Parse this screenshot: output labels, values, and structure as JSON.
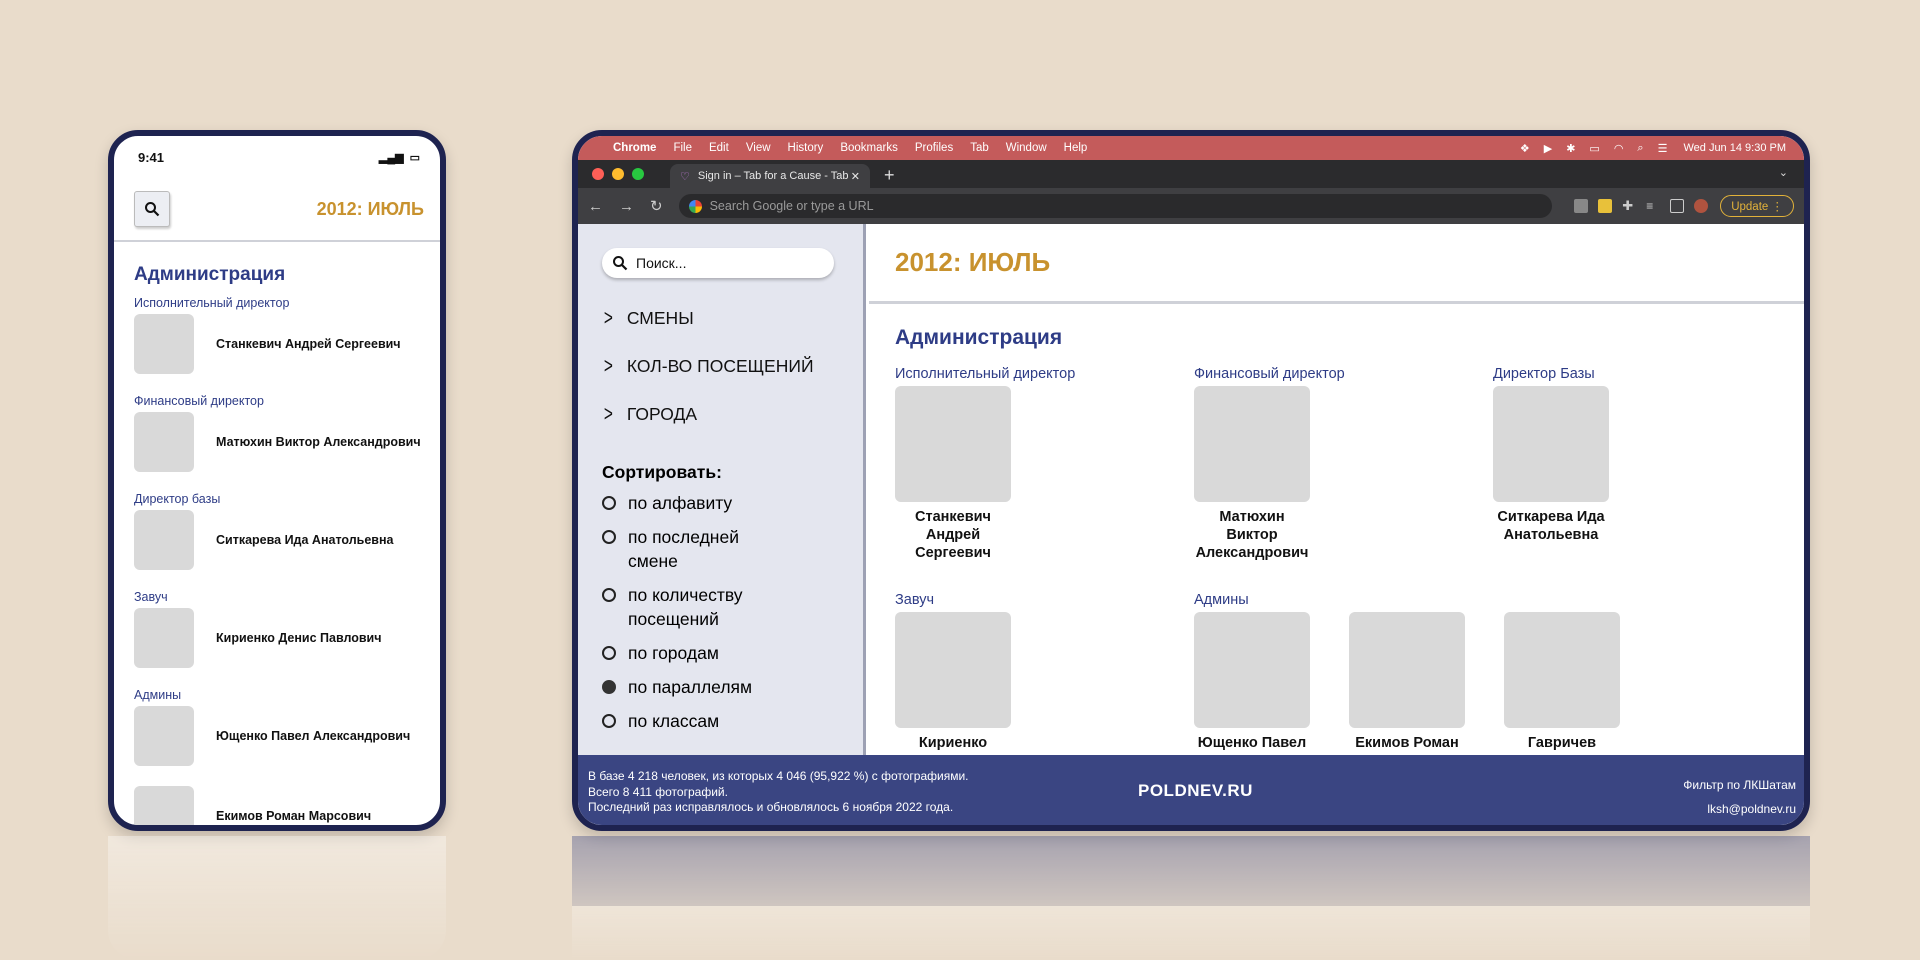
{
  "phone": {
    "status": {
      "time": "9:41"
    },
    "header": {
      "title": "2012: ИЮЛЬ"
    },
    "section": "Администрация",
    "entries": [
      {
        "role": "Исполнительный директор",
        "name": "Станкевич Андрей Сергеевич"
      },
      {
        "role": "Финансовый директор",
        "name": "Матюхин Виктор Александрович"
      },
      {
        "role": "Директор базы",
        "name": "Ситкарева Ида Анатольевна"
      },
      {
        "role": "Завуч",
        "name": "Кириенко Денис Павлович"
      },
      {
        "role": "Админы",
        "name": "Ющенко Павел Александрович"
      },
      {
        "role": "",
        "name": "Екимов Роман Марсович"
      }
    ]
  },
  "mac": {
    "menu": [
      "Chrome",
      "File",
      "Edit",
      "View",
      "History",
      "Bookmarks",
      "Profiles",
      "Tab",
      "Window",
      "Help"
    ],
    "datetime": "Wed Jun 14  9:30 PM"
  },
  "browser": {
    "tab_title": "Sign in – Tab for a Cause - Tab",
    "omnibox_placeholder": "Search Google or type a URL",
    "update_label": "Update"
  },
  "sidebar": {
    "search_placeholder": "Поиск...",
    "menu": [
      "СМЕНЫ",
      "КОЛ-ВО ПОСЕЩЕНИЙ",
      "ГОРОДА"
    ],
    "sort_label": "Сортировать:",
    "sort_options": [
      {
        "label": "по алфавиту",
        "selected": false
      },
      {
        "label": "по последней смене",
        "selected": false
      },
      {
        "label": "по количеству посещений",
        "selected": false
      },
      {
        "label": "по городам",
        "selected": false
      },
      {
        "label": "по параллелям",
        "selected": true
      },
      {
        "label": "по классам",
        "selected": false
      }
    ]
  },
  "main": {
    "title": "2012: ИЮЛЬ",
    "section": "Администрация",
    "groups": [
      {
        "role": "Исполнительный директор",
        "people": [
          "Станкевич Андрей Сергеевич"
        ]
      },
      {
        "role": "Финансовый директор",
        "people": [
          "Матюхин Виктор Александрович"
        ]
      },
      {
        "role": "Директор Базы",
        "people": [
          "Ситкарева Ида Анатольевна"
        ]
      },
      {
        "role": "Завуч",
        "people": [
          "Кириенко"
        ]
      },
      {
        "role": "Админы",
        "people": [
          "Ющенко Павел",
          "Екимов Роман",
          "Гавричев"
        ]
      }
    ]
  },
  "footer": {
    "info": [
      "В базе 4 218 человек, из которых 4 046 (95,922 %) с фотографиями.",
      "Всего 8 411 фотографий.",
      "Последний раз исправлялось и обновлялось 6 ноября 2022 года."
    ],
    "brand": "POLDNEV.RU",
    "filter_link": "Фильтр по ЛКШатам",
    "email": "lksh@poldnev.ru"
  },
  "colors": {
    "background": "#e9dccb",
    "frame": "#1e2350",
    "accent_gold": "#c8922e",
    "accent_blue": "#2e3c86",
    "footer": "#3a4582",
    "menubar": "#c45b5b"
  }
}
